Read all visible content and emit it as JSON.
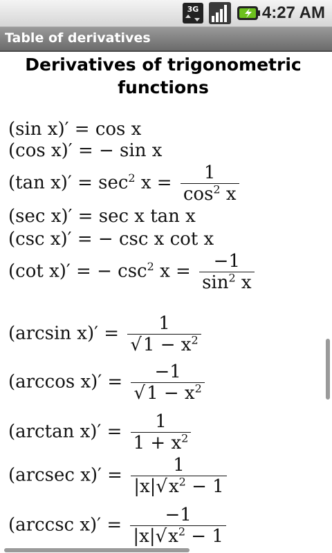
{
  "status": {
    "time": "4:27 AM"
  },
  "app": {
    "title": "Table of derivatives"
  },
  "page": {
    "heading": "Derivatives of trigonometric functions"
  },
  "formulas": {
    "sin": {
      "lhs": "(sin x)′ = ",
      "rhs": "cos x"
    },
    "cos": {
      "lhs": "(cos x)′ = ",
      "rhs": "− sin x"
    },
    "tan": {
      "lhs": "(tan x)′ = sec",
      "rhs": " x = ",
      "num": "1",
      "den": "cos",
      "den2": " x"
    },
    "sec": {
      "lhs": "(sec x)′ = ",
      "rhs": "sec x tan x"
    },
    "csc": {
      "lhs": "(csc x)′ = ",
      "rhs": "− csc x cot x"
    },
    "cot": {
      "lhs": "(cot x)′ = − csc",
      "rhs": " x = ",
      "num": "−1",
      "den": "sin",
      "den2": " x"
    },
    "arcsin": {
      "lhs": "(arcsin x)′ = ",
      "num": "1",
      "den": "1 − x"
    },
    "arccos": {
      "lhs": "(arccos x)′ = ",
      "num": "−1",
      "den": "1 − x"
    },
    "arctan": {
      "lhs": "(arctan x)′ = ",
      "num": "1",
      "den": "1 + x"
    },
    "arcsec": {
      "lhs": "(arcsec x)′ = ",
      "num": "1",
      "den_abs": "|x|",
      "den": "x",
      "den2": " − 1"
    },
    "arccsc": {
      "lhs": "(arccsc x)′ = ",
      "num": "−1",
      "den_abs": "|x|",
      "den": "x",
      "den2": " − 1"
    }
  },
  "symbols": {
    "square": "2",
    "sqrt": "√"
  }
}
